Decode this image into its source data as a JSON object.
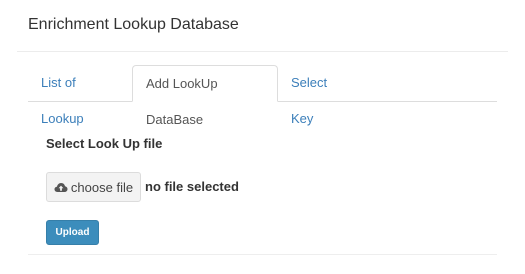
{
  "page": {
    "title": "Enrichment Lookup Database"
  },
  "tabs": [
    {
      "label": "List of Lookup",
      "active": false
    },
    {
      "label": "Add LookUp DataBase",
      "active": true
    },
    {
      "label": "Select Key",
      "active": false
    }
  ],
  "form": {
    "file_label": "Select Look Up file",
    "choose_file_label": "choose file",
    "file_status": "no file selected",
    "upload_label": "Upload"
  },
  "icons": {
    "choose_file": "cloud-upload-icon"
  },
  "colors": {
    "link": "#3c7fba",
    "primary_button": "#3c8dbc"
  }
}
